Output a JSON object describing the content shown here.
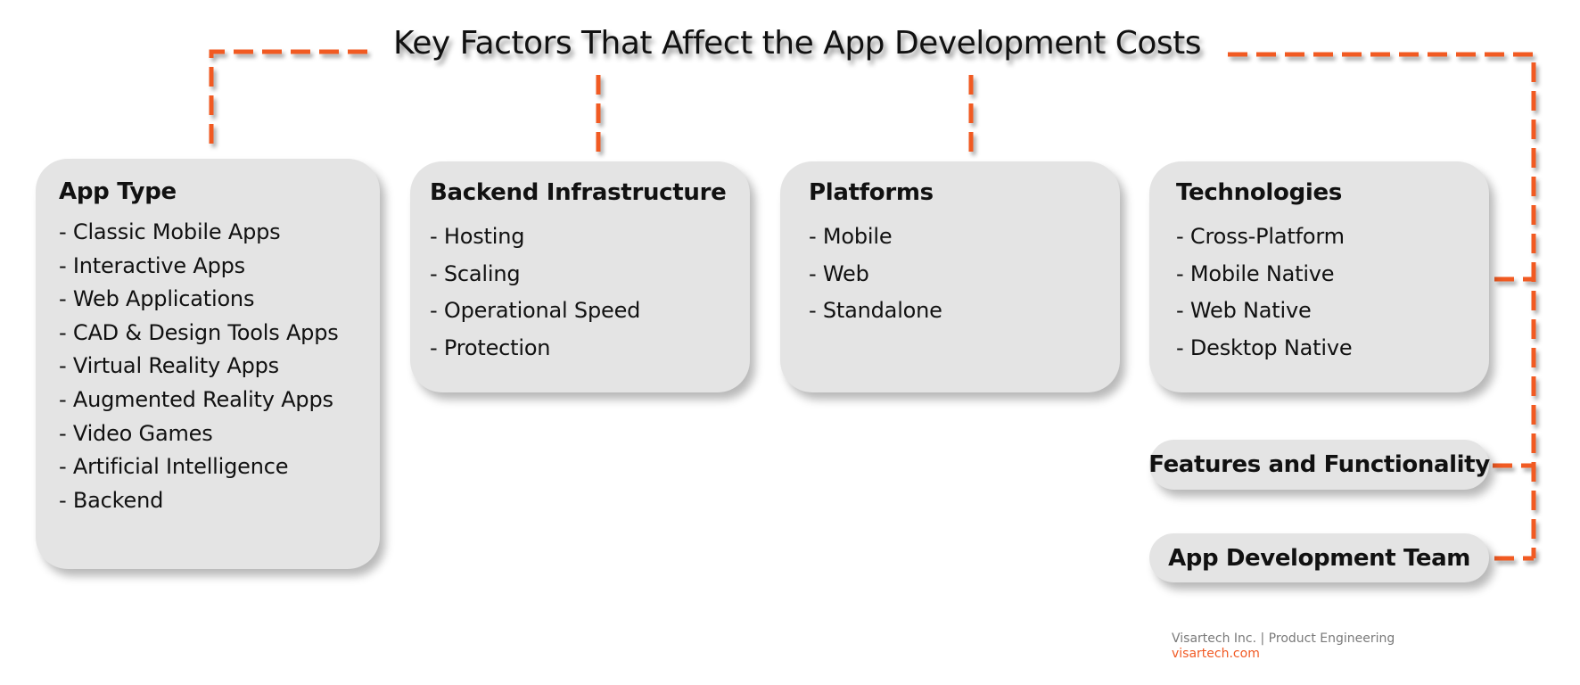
{
  "title": "Key Factors That Affect the App Development Costs",
  "colors": {
    "accent": "#F15A24",
    "card_background": "#E4E4E4",
    "text": "#111111",
    "footer_text": "#7A7A7A"
  },
  "cards": [
    {
      "heading": "App Type",
      "items": [
        "- Classic Mobile Apps",
        "- Interactive Apps",
        "- Web Applications",
        "- CAD & Design Tools Apps",
        "- Virtual Reality Apps",
        "- Augmented Reality Apps",
        "- Video Games",
        "- Artificial Intelligence",
        "- Backend"
      ]
    },
    {
      "heading": "Backend Infrastructure",
      "items": [
        "- Hosting",
        "- Scaling",
        "- Operational Speed",
        "- Protection"
      ]
    },
    {
      "heading": "Platforms",
      "items": [
        "- Mobile",
        "- Web",
        "- Standalone"
      ]
    },
    {
      "heading": "Technologies",
      "items": [
        "- Cross-Platform",
        "- Mobile Native",
        "- Web Native",
        "- Desktop Native"
      ]
    }
  ],
  "pills": [
    {
      "label": "Features and Functionality"
    },
    {
      "label": "App Development Team"
    }
  ],
  "footer": {
    "company": "Visartech Inc. | Product Engineering",
    "url": "visartech.com"
  }
}
